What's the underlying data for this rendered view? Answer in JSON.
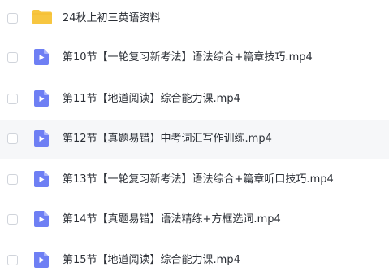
{
  "files": [
    {
      "type": "folder",
      "name": "24秋上初三英语资料"
    },
    {
      "type": "video",
      "name": "第10节【一轮复习新考法】语法综合+篇章技巧.mp4"
    },
    {
      "type": "video",
      "name": "第11节【地道阅读】综合能力课.mp4"
    },
    {
      "type": "video",
      "name": "第12节【真题易错】中考词汇写作训练.mp4"
    },
    {
      "type": "video",
      "name": "第13节【一轮复习新考法】语法综合+篇章听口技巧.mp4"
    },
    {
      "type": "video",
      "name": "第14节【真题易错】语法精练+方框选词.mp4"
    },
    {
      "type": "video",
      "name": "第15节【地道阅读】综合能力课.mp4"
    }
  ],
  "colors": {
    "folder": "#f7c640",
    "video": "#6e7ff4",
    "hover_row": "#f6f7f9"
  },
  "icons": {
    "folder": "folder-icon",
    "video": "video-file-icon"
  }
}
